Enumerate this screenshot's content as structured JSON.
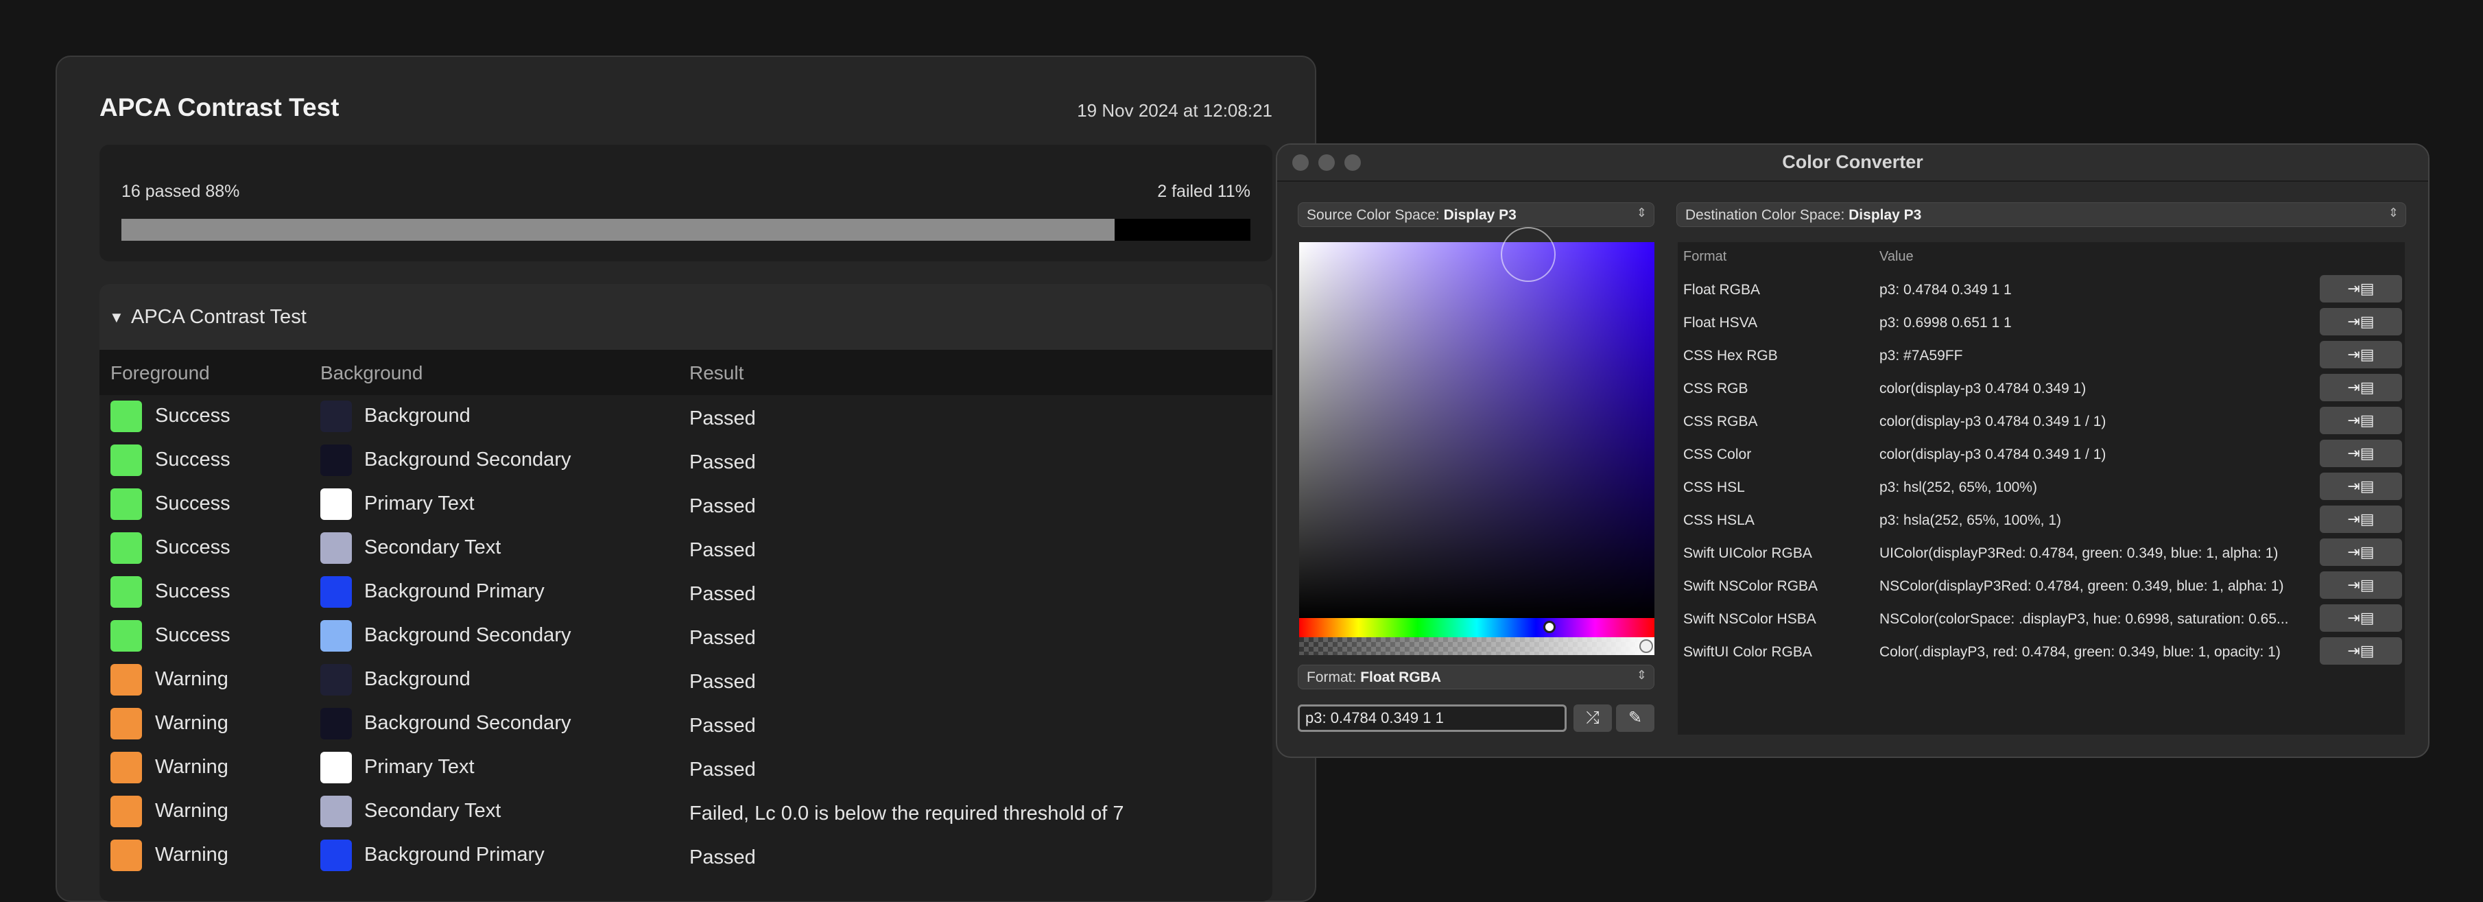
{
  "apca": {
    "title": "APCA Contrast Test",
    "date": "19 Nov 2024 at 12:08:21",
    "passed_label": "16 passed 88%",
    "failed_label": "2 failed 11%",
    "passed_fraction": 0.88,
    "group_title": "APCA Contrast Test",
    "columns": [
      "Foreground",
      "Background",
      "Result"
    ],
    "rows": [
      {
        "fg": "Success",
        "fg_color": "#5ee65a",
        "bg": "Background",
        "bg_color": "#1f2035",
        "result": "Passed"
      },
      {
        "fg": "Success",
        "fg_color": "#5ee65a",
        "bg": "Background Secondary",
        "bg_color": "#121224",
        "result": "Passed"
      },
      {
        "fg": "Success",
        "fg_color": "#5ee65a",
        "bg": "Primary Text",
        "bg_color": "#ffffff",
        "result": "Passed"
      },
      {
        "fg": "Success",
        "fg_color": "#5ee65a",
        "bg": "Secondary Text",
        "bg_color": "#a9acc8",
        "result": "Passed"
      },
      {
        "fg": "Success",
        "fg_color": "#5ee65a",
        "bg": "Background Primary",
        "bg_color": "#1b40f0",
        "result": "Passed"
      },
      {
        "fg": "Success",
        "fg_color": "#5ee65a",
        "bg": "Background Secondary",
        "bg_color": "#86b3f5",
        "result": "Passed"
      },
      {
        "fg": "Warning",
        "fg_color": "#f2913a",
        "bg": "Background",
        "bg_color": "#1f2035",
        "result": "Passed"
      },
      {
        "fg": "Warning",
        "fg_color": "#f2913a",
        "bg": "Background Secondary",
        "bg_color": "#121224",
        "result": "Passed"
      },
      {
        "fg": "Warning",
        "fg_color": "#f2913a",
        "bg": "Primary Text",
        "bg_color": "#ffffff",
        "result": "Passed"
      },
      {
        "fg": "Warning",
        "fg_color": "#f2913a",
        "bg": "Secondary Text",
        "bg_color": "#a9acc8",
        "result": "Failed, Lc 0.0 is below the required threshold of 7"
      },
      {
        "fg": "Warning",
        "fg_color": "#f2913a",
        "bg": "Background Primary",
        "bg_color": "#1b40f0",
        "result": "Passed"
      }
    ]
  },
  "converter": {
    "title": "Color Converter",
    "source_label": "Source Color Space:",
    "source_value": "Display P3",
    "dest_label": "Destination Color Space:",
    "dest_value": "Display P3",
    "format_label": "Format:",
    "format_value": "Float RGBA",
    "input_value": "p3: 0.4784 0.349 1 1",
    "table_headers": [
      "Format",
      "Value"
    ],
    "rows": [
      {
        "format": "Float RGBA",
        "value": "p3: 0.4784 0.349 1 1"
      },
      {
        "format": "Float HSVA",
        "value": "p3: 0.6998 0.651 1 1"
      },
      {
        "format": "CSS Hex RGB",
        "value": "p3: #7A59FF"
      },
      {
        "format": "CSS RGB",
        "value": "color(display-p3 0.4784 0.349 1)"
      },
      {
        "format": "CSS RGBA",
        "value": "color(display-p3 0.4784 0.349 1 / 1)"
      },
      {
        "format": "CSS Color",
        "value": "color(display-p3 0.4784 0.349 1 / 1)"
      },
      {
        "format": "CSS HSL",
        "value": "p3: hsl(252, 65%, 100%)"
      },
      {
        "format": "CSS HSLA",
        "value": "p3: hsla(252, 65%, 100%, 1)"
      },
      {
        "format": "Swift UIColor RGBA",
        "value": "UIColor(displayP3Red: 0.4784, green: 0.349, blue: 1, alpha: 1)"
      },
      {
        "format": "Swift NSColor RGBA",
        "value": "NSColor(displayP3Red: 0.4784, green: 0.349, blue: 1, alpha: 1)"
      },
      {
        "format": "Swift NSColor HSBA",
        "value": "NSColor(colorSpace: .displayP3, hue: 0.6998, saturation: 0.65..."
      },
      {
        "format": "SwiftUI Color RGBA",
        "value": "Color(.displayP3, red: 0.4784, green: 0.349, blue: 1, opacity: 1)"
      }
    ]
  },
  "colors": {
    "accent_hue": "#3300ff"
  }
}
